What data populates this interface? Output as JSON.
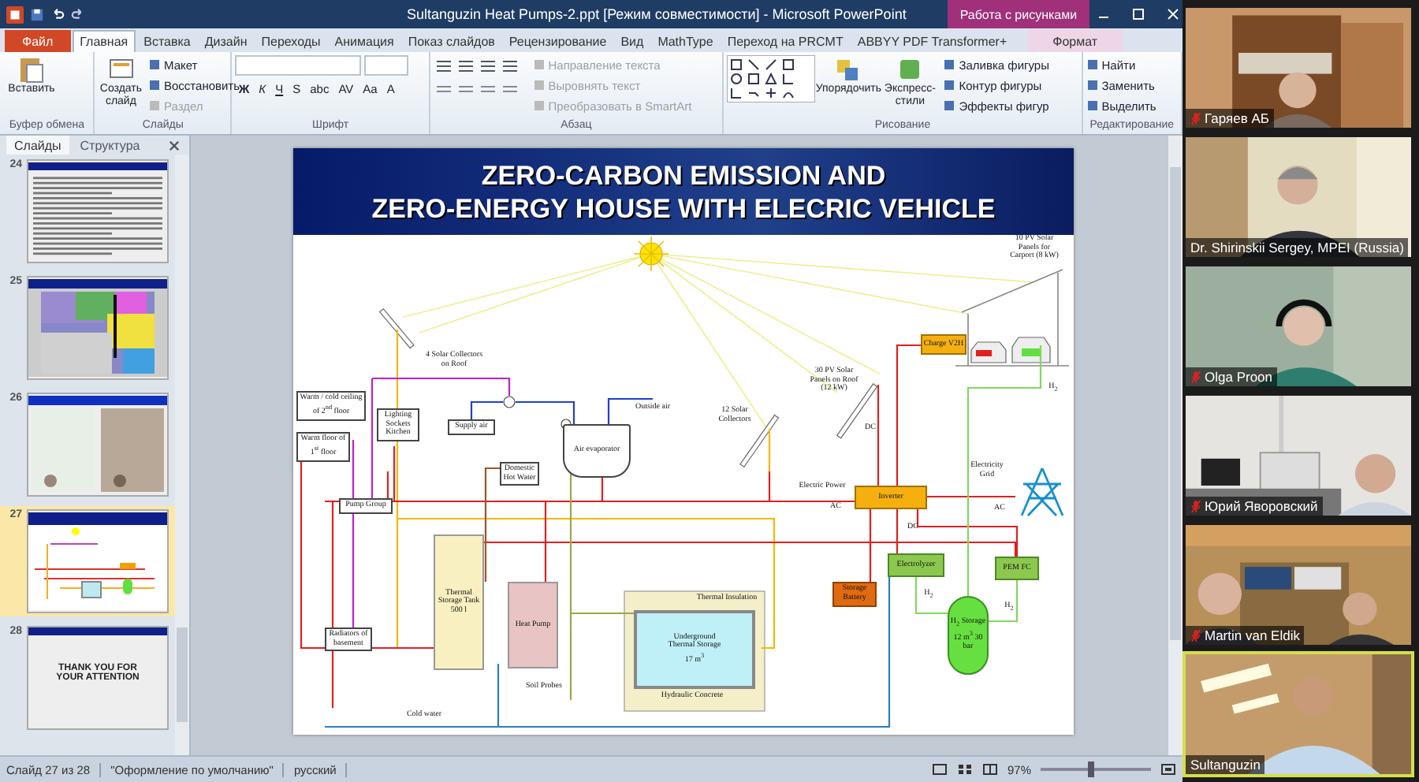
{
  "window": {
    "title": "Sultanguzin Heat Pumps-2.ppt [Режим совместимости] - Microsoft PowerPoint",
    "context_tab": "Работа с рисунками"
  },
  "ribbon_tabs": [
    {
      "label": "Файл",
      "kind": "file",
      "selected": false
    },
    {
      "label": "Главная",
      "kind": "tab",
      "selected": true
    },
    {
      "label": "Вставка",
      "kind": "tab",
      "selected": false
    },
    {
      "label": "Дизайн",
      "kind": "tab",
      "selected": false
    },
    {
      "label": "Переходы",
      "kind": "tab",
      "selected": false
    },
    {
      "label": "Анимация",
      "kind": "tab",
      "selected": false
    },
    {
      "label": "Показ слайдов",
      "kind": "tab",
      "selected": false
    },
    {
      "label": "Рецензирование",
      "kind": "tab",
      "selected": false
    },
    {
      "label": "Вид",
      "kind": "tab",
      "selected": false
    },
    {
      "label": "MathType",
      "kind": "tab",
      "selected": false
    },
    {
      "label": "Переход на PRCMT",
      "kind": "tab",
      "selected": false
    },
    {
      "label": "ABBYY PDF Transformer+",
      "kind": "tab",
      "selected": false
    },
    {
      "label": "Формат",
      "kind": "context",
      "selected": false
    }
  ],
  "ribbon_groups": [
    {
      "label": "Буфер обмена",
      "kind": "clipboard",
      "buttons": [
        {
          "label": "Вставить",
          "kind": "large",
          "disabled": false
        }
      ]
    },
    {
      "label": "Слайды",
      "kind": "slides",
      "buttons": [
        {
          "label": "Создать слайд",
          "kind": "large",
          "disabled": false
        },
        {
          "label": "Макет",
          "kind": "small",
          "disabled": false
        },
        {
          "label": "Восстановить",
          "kind": "small",
          "disabled": false
        },
        {
          "label": "Раздел",
          "kind": "small",
          "disabled": true
        }
      ]
    },
    {
      "label": "Шрифт",
      "kind": "font",
      "buttons": [
        {
          "label": "Ж",
          "kind": "glyph"
        },
        {
          "label": "К",
          "kind": "glyph"
        },
        {
          "label": "Ч",
          "kind": "glyph"
        },
        {
          "label": "S",
          "kind": "glyph"
        },
        {
          "label": "abc",
          "kind": "glyph"
        },
        {
          "label": "AV",
          "kind": "glyph"
        },
        {
          "label": "Aa",
          "kind": "glyph"
        },
        {
          "label": "A",
          "kind": "glyph"
        }
      ]
    },
    {
      "label": "Абзац",
      "kind": "paragraph",
      "buttons": [
        {
          "label": "Направление текста",
          "kind": "small",
          "disabled": true
        },
        {
          "label": "Выровнять текст",
          "kind": "small",
          "disabled": true
        },
        {
          "label": "Преобразовать в SmartArt",
          "kind": "small",
          "disabled": true
        }
      ]
    },
    {
      "label": "Рисование",
      "kind": "drawing",
      "buttons": [
        {
          "label": "Упорядочить",
          "kind": "large",
          "disabled": false
        },
        {
          "label": "Экспресс-стили",
          "kind": "large",
          "disabled": false
        },
        {
          "label": "Заливка фигуры",
          "kind": "small",
          "disabled": false
        },
        {
          "label": "Контур фигуры",
          "kind": "small",
          "disabled": false
        },
        {
          "label": "Эффекты фигур",
          "kind": "small",
          "disabled": false
        }
      ]
    },
    {
      "label": "Редактирование",
      "kind": "editing",
      "buttons": [
        {
          "label": "Найти",
          "kind": "small",
          "disabled": false
        },
        {
          "label": "Заменить",
          "kind": "small",
          "disabled": false
        },
        {
          "label": "Выделить",
          "kind": "small",
          "disabled": false
        }
      ]
    }
  ],
  "slide_panel": {
    "tabs": [
      {
        "label": "Слайды",
        "selected": true
      },
      {
        "label": "Структура",
        "selected": false
      }
    ],
    "thumbnails": [
      {
        "number": "24",
        "kind": "text",
        "selected": false
      },
      {
        "number": "25",
        "kind": "map",
        "selected": false
      },
      {
        "number": "26",
        "kind": "certificates",
        "selected": false
      },
      {
        "number": "27",
        "kind": "diagram",
        "selected": true
      },
      {
        "number": "28",
        "kind": "closing",
        "selected": false,
        "text": "THANK YOU FOR YOUR ATTENTION"
      }
    ]
  },
  "slide": {
    "title_lines": [
      "ZERO-CARBON EMISSION AND",
      "ZERO-ENERGY HOUSE WITH ELECRIC VEHICLE"
    ],
    "labels": [
      {
        "text": "4 Solar Collectors on Roof",
        "kind": "plain"
      },
      {
        "text": "Warm / cold ceiling of 2$^{nd}$ floor",
        "kind": "box"
      },
      {
        "text": "Warm floor of 1$^{st}$ floor",
        "kind": "box"
      },
      {
        "text": "Lighting Sockets Kitchen",
        "kind": "box"
      },
      {
        "text": "Supply air",
        "kind": "box"
      },
      {
        "text": "Outside air",
        "kind": "plain"
      },
      {
        "text": "Air evaporator",
        "kind": "evaporator"
      },
      {
        "text": "Domestic Hot Water",
        "kind": "box"
      },
      {
        "text": "Pump Group",
        "kind": "box"
      },
      {
        "text": "12 Solar Collectors",
        "kind": "plain"
      },
      {
        "text": "30 PV Solar Panels on Roof (12 kW)",
        "kind": "plain"
      },
      {
        "text": "10 PV Solar Panels for Carport (8 kW)",
        "kind": "plain"
      },
      {
        "text": "Charge V2H",
        "kind": "orange"
      },
      {
        "text": "Electric Power",
        "kind": "plain"
      },
      {
        "text": "AC",
        "kind": "plain"
      },
      {
        "text": "Inverter",
        "kind": "orange"
      },
      {
        "text": "Electricity Grid",
        "kind": "plain"
      },
      {
        "text": "AC",
        "kind": "plain"
      },
      {
        "text": "DC",
        "kind": "plain"
      },
      {
        "text": "H$_{2}$",
        "kind": "plain"
      },
      {
        "text": "DC",
        "kind": "plain"
      },
      {
        "text": "Electrolyzer",
        "kind": "green"
      },
      {
        "text": "PEM FC",
        "kind": "green"
      },
      {
        "text": "Storage Battery",
        "kind": "darkorange"
      },
      {
        "text": "H$_{2}$",
        "kind": "plain"
      },
      {
        "text": "H$_{2}$ Storage 12 m$^{3}$ 30 bar",
        "kind": "ellipse"
      },
      {
        "text": "H$_{2}$",
        "kind": "plain"
      },
      {
        "text": "Thermal Storage Tank 500 l",
        "kind": "tank"
      },
      {
        "text": "Heat Pump",
        "kind": "pink"
      },
      {
        "text": "Radiators of basement",
        "kind": "box"
      },
      {
        "text": "Thermal Insulation",
        "kind": "plain"
      },
      {
        "text": "Underground Thermal Storage 17 m$^{3}$",
        "kind": "storage"
      },
      {
        "text": "Hydraulic Concrete",
        "kind": "plain"
      },
      {
        "text": "Soil Probes",
        "kind": "plain"
      },
      {
        "text": "Cold water",
        "kind": "plain"
      }
    ]
  },
  "status_bar": {
    "slide": "Слайд 27 из 28",
    "theme": "\"Оформление по умолчанию\"",
    "language": "русский",
    "zoom": "97%",
    "zoom_slider": {
      "level": 0.45
    }
  },
  "participants": [
    {
      "name": "Гаряев АБ",
      "kind": "shelves",
      "muted": true,
      "speaking": false
    },
    {
      "name": "Dr. Shirinskii Sergey, MPEI (Russia)",
      "kind": "blur",
      "muted": false,
      "speaking": false
    },
    {
      "name": "Olga Proon",
      "kind": "headphones",
      "muted": true,
      "speaking": false
    },
    {
      "name": "Юрий Яворовский",
      "kind": "office",
      "muted": true,
      "speaking": false
    },
    {
      "name": "Martin van Eldik",
      "kind": "bookcase",
      "muted": true,
      "speaking": false
    },
    {
      "name": "Sultanguzin",
      "kind": "ceiling",
      "muted": false,
      "speaking": true
    }
  ]
}
